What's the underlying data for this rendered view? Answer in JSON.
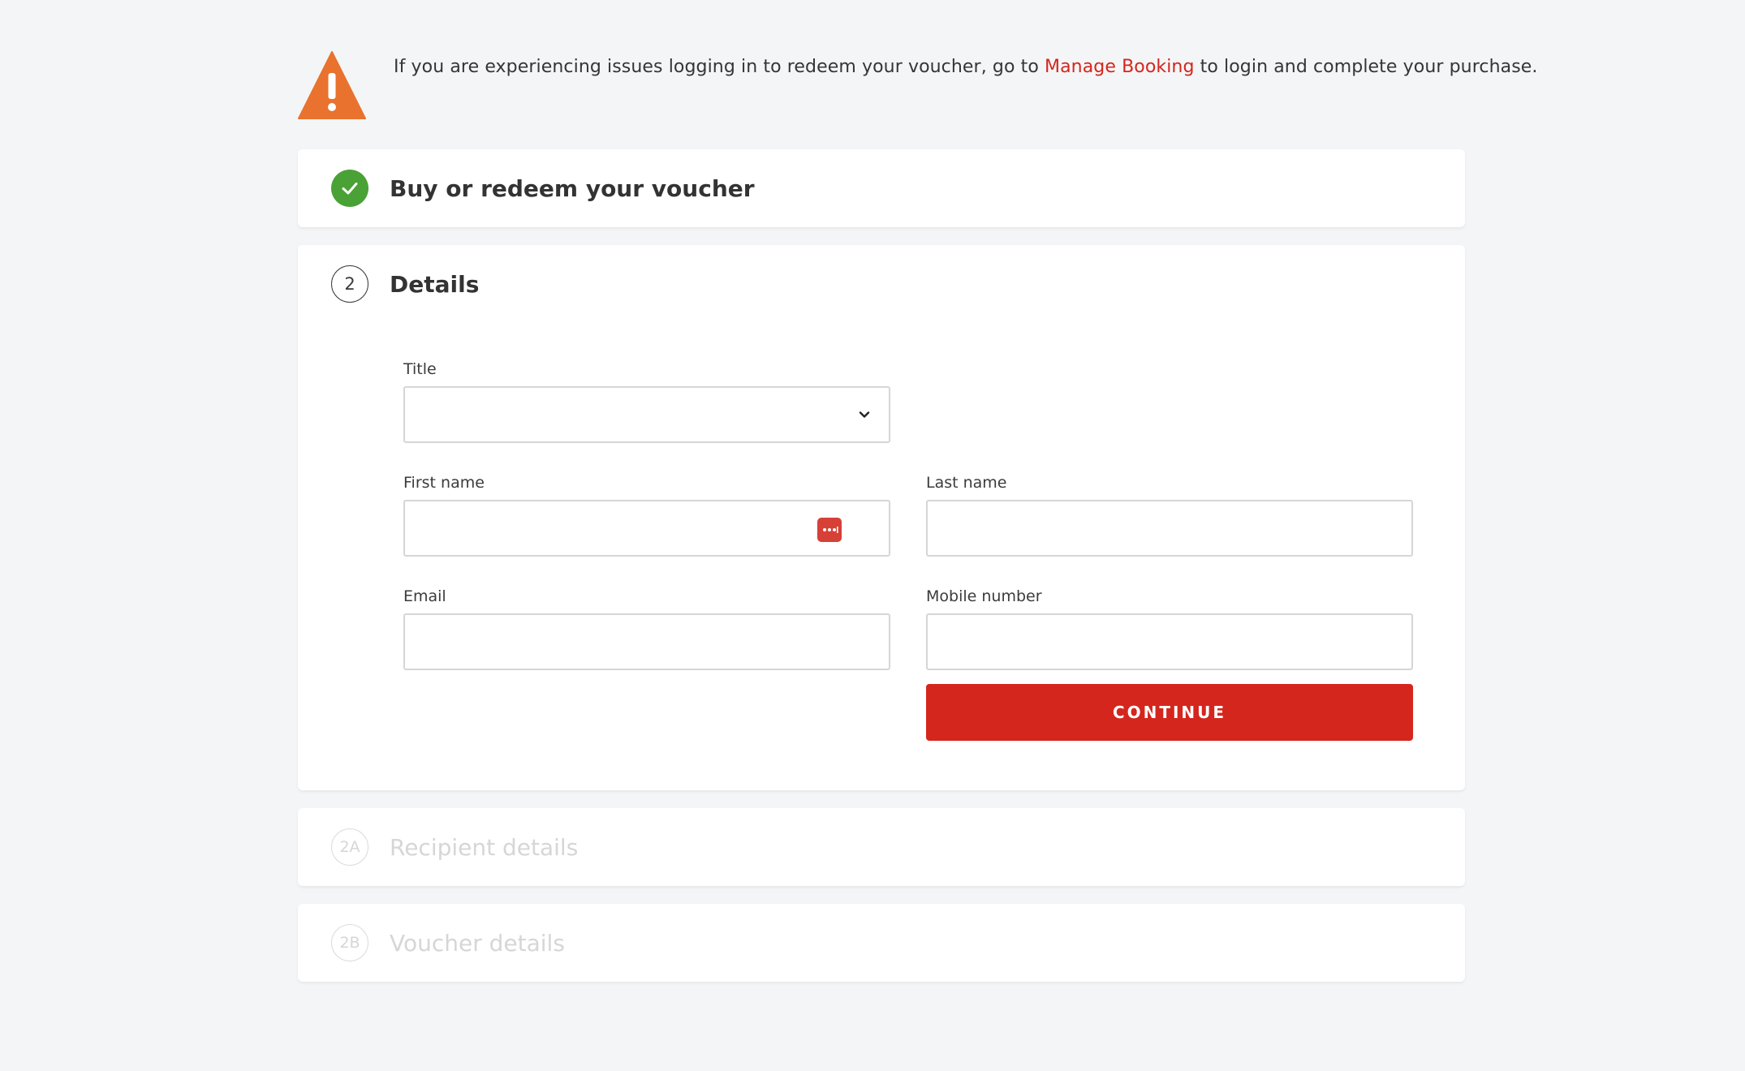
{
  "alert": {
    "icon": "warning-triangle-icon",
    "icon_color": "#e8722e",
    "text_before": "If you are experiencing issues logging in to redeem your voucher, go to ",
    "link_text": "Manage Booking",
    "text_after": " to login and complete your purchase."
  },
  "steps": [
    {
      "badge": "",
      "badge_icon": "checkmark-icon",
      "title": "Buy or redeem your voucher",
      "state": "completed"
    },
    {
      "badge": "2",
      "title": "Details",
      "state": "active"
    },
    {
      "badge": "2A",
      "title": "Recipient details",
      "state": "inactive"
    },
    {
      "badge": "2B",
      "title": "Voucher details",
      "state": "inactive"
    }
  ],
  "form": {
    "title_label": "Title",
    "title_value": "",
    "first_name_label": "First name",
    "first_name_value": "",
    "last_name_label": "Last name",
    "last_name_value": "",
    "email_label": "Email",
    "email_value": "",
    "mobile_label": "Mobile number",
    "mobile_value": "",
    "continue_label": "CONTINUE"
  },
  "colors": {
    "accent": "#d4261d",
    "success": "#4aa135",
    "warning": "#e8722e",
    "background": "#f4f5f6"
  }
}
